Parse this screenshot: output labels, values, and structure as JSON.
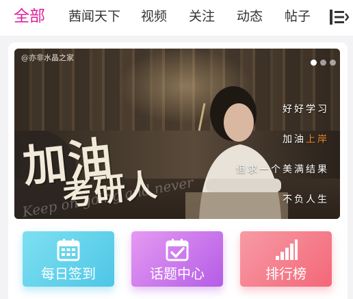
{
  "tabs": [
    {
      "label": "全部",
      "active": true
    },
    {
      "label": "茜闻天下",
      "active": false
    },
    {
      "label": "视频",
      "active": false
    },
    {
      "label": "关注",
      "active": false
    },
    {
      "label": "动态",
      "active": false
    },
    {
      "label": "帖子",
      "active": false
    }
  ],
  "menu_icon": "hamburger-menu-icon",
  "banner": {
    "watermark": "@亦非水晶之家",
    "calligraphy_line1": "加油",
    "calligraphy_line2": "考研人",
    "script_text": "Keep on going and never",
    "slogans": {
      "line1": "好好学习",
      "line2_prefix": "加油",
      "line2_highlight": "上岸",
      "line3": "但求一个美满结果",
      "line4": "不负人生"
    },
    "pager": {
      "count": 3,
      "active": 1
    }
  },
  "quick_actions": [
    {
      "label": "每日签到",
      "icon": "calendar-grid-icon",
      "color": "#4ec6e6"
    },
    {
      "label": "话题中心",
      "icon": "calendar-check-icon",
      "color": "#b45de6"
    },
    {
      "label": "排行榜",
      "icon": "signal-bars-icon",
      "color": "#f36878"
    }
  ],
  "colors": {
    "accent": "#e0209a",
    "highlight": "#f08a2c"
  }
}
